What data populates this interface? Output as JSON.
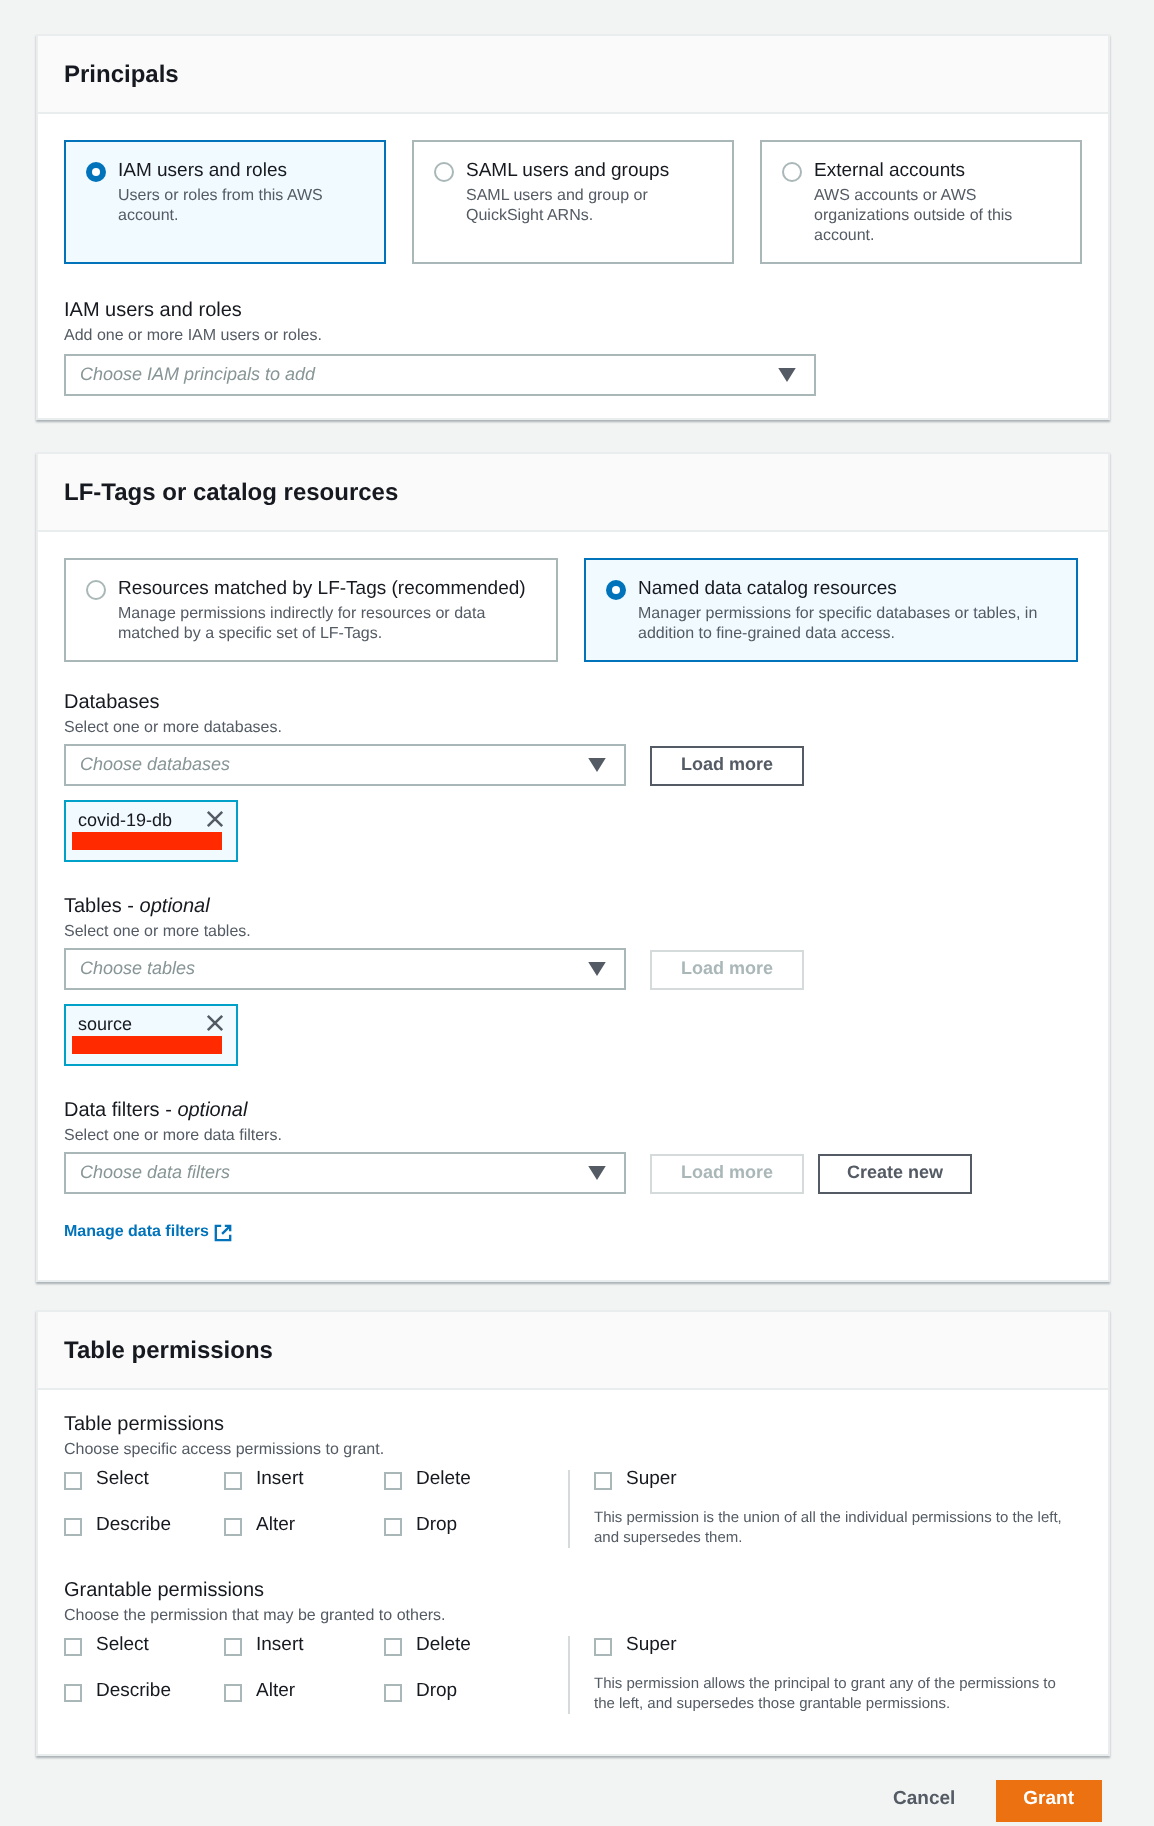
{
  "principals": {
    "title": "Principals",
    "options": [
      {
        "label": "IAM users and roles",
        "description": "Users or roles from this AWS account.",
        "selected": true
      },
      {
        "label": "SAML users and groups",
        "description": "SAML users and group or QuickSight ARNs.",
        "selected": false
      },
      {
        "label": "External accounts",
        "description": "AWS accounts or AWS organizations outside of this account.",
        "selected": false
      }
    ],
    "field": {
      "label": "IAM users and roles",
      "description": "Add one or more IAM users or roles.",
      "placeholder": "Choose IAM principals to add"
    }
  },
  "resources": {
    "title": "LF-Tags or catalog resources",
    "options": [
      {
        "label": "Resources matched by LF-Tags (recommended)",
        "description": "Manage permissions indirectly for resources or data matched by a specific set of LF-Tags.",
        "selected": false
      },
      {
        "label": "Named data catalog resources",
        "description": "Manager permissions for specific databases or tables, in addition to fine-grained data access.",
        "selected": true
      }
    ],
    "fields": [
      {
        "label": "Databases",
        "description": "Select one or more databases.",
        "placeholder": "Choose databases",
        "buttons": [
          {
            "label": "Load more",
            "disabled": false
          }
        ],
        "tokens": [
          "covid-19-db"
        ]
      },
      {
        "label": "Tables - *optional*",
        "description": "Select one or more tables.",
        "placeholder": "Choose tables",
        "buttons": [
          {
            "label": "Load more",
            "disabled": true
          }
        ],
        "tokens": [
          "source"
        ]
      },
      {
        "label": "Data filters - *optional*",
        "description": "Select one or more data filters.",
        "placeholder": "Choose data filters",
        "buttons": [
          {
            "label": "Load more",
            "disabled": true
          },
          {
            "label": "Create new",
            "disabled": false
          }
        ]
      }
    ],
    "link": "Manage data filters"
  },
  "table_permissions": {
    "title": "Table permissions",
    "groups": [
      {
        "label": "Table permissions",
        "description": "Choose specific access permissions to grant.",
        "items": [
          {
            "label": "Select",
            "checked": false
          },
          {
            "label": "Insert",
            "checked": false
          },
          {
            "label": "Delete",
            "checked": false
          },
          {
            "label": "Describe",
            "checked": false
          },
          {
            "label": "Alter",
            "checked": false
          },
          {
            "label": "Drop",
            "checked": false
          }
        ],
        "super": {
          "label": "Super",
          "checked": false,
          "description": "This permission is the union of all the individual permissions to the left, and supersedes them."
        }
      },
      {
        "label": "Grantable permissions",
        "description": "Choose the permission that may be granted to others.",
        "items": [
          {
            "label": "Select",
            "checked": false
          },
          {
            "label": "Insert",
            "checked": false
          },
          {
            "label": "Delete",
            "checked": false
          },
          {
            "label": "Describe",
            "checked": false
          },
          {
            "label": "Alter",
            "checked": false
          },
          {
            "label": "Drop",
            "checked": false
          }
        ],
        "super": {
          "label": "Super",
          "checked": false,
          "description": "This permission allows the principal to grant any of the permissions to the left, and supersedes those grantable permissions."
        }
      }
    ]
  },
  "actions": [
    {
      "label": "Cancel",
      "kind": "link"
    },
    {
      "label": "Grant",
      "kind": "primary"
    }
  ]
}
